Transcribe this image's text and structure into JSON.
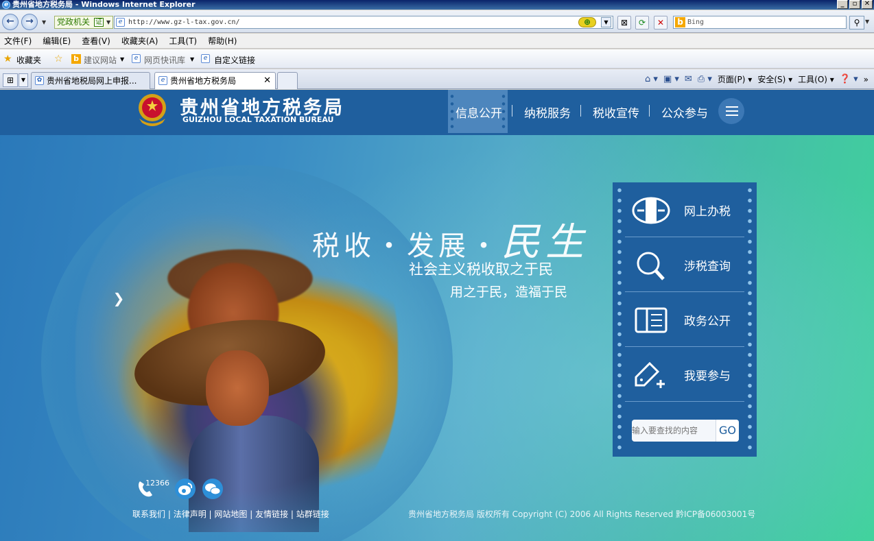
{
  "window": {
    "title": "贵州省地方税务局 - Windows Internet Explorer"
  },
  "browser": {
    "zone_label": "党政机关",
    "zone_cert": "证",
    "address": "http://www.gz-l-tax.gov.cn/",
    "search_placeholder": "Bing",
    "menu": [
      "文件(F)",
      "编辑(E)",
      "查看(V)",
      "收藏夹(A)",
      "工具(T)",
      "帮助(H)"
    ],
    "favorites": {
      "label": "收藏夹",
      "items": [
        "建议网站",
        "网页快讯库",
        "自定义链接"
      ]
    },
    "tabs": [
      {
        "label": "贵州省地税局网上申报..."
      },
      {
        "label": "贵州省地方税务局"
      }
    ],
    "commands": {
      "page": "页面(P)",
      "safety": "安全(S)",
      "tools": "工具(O)"
    }
  },
  "site": {
    "name": "贵州省地方税务局",
    "name_en": "GUIZHOU LOCAL TAXATION BUREAU",
    "nav": [
      "信息公开",
      "纳税服务",
      "税收宣传",
      "公众参与"
    ]
  },
  "hero": {
    "slogan_part1": "税收・发展・",
    "slogan_part2": "民生",
    "line2": "社会主义税收取之于民",
    "line3": "用之于民，造福于民"
  },
  "services": {
    "items": [
      {
        "label": "网上办税",
        "icon": "tax-emblem-icon"
      },
      {
        "label": "涉税查询",
        "icon": "magnifier-icon"
      },
      {
        "label": "政务公开",
        "icon": "book-icon"
      },
      {
        "label": "我要参与",
        "icon": "tag-plus-icon"
      }
    ],
    "search_placeholder": "输入要查找的内容",
    "search_go": "GO"
  },
  "footer": {
    "hotline": "12366",
    "links": [
      "联系我们",
      "法律声明",
      "网站地图",
      "友情链接",
      "站群链接"
    ],
    "copyright": "贵州省地方税务局 版权所有 Copyright (C) 2006 All Rights Reserved 黔ICP备06003001号"
  },
  "colors": {
    "header_blue": "#1f5f9e",
    "panel_blue": "#1f5f9e",
    "nav_active": "#4d86bd"
  }
}
